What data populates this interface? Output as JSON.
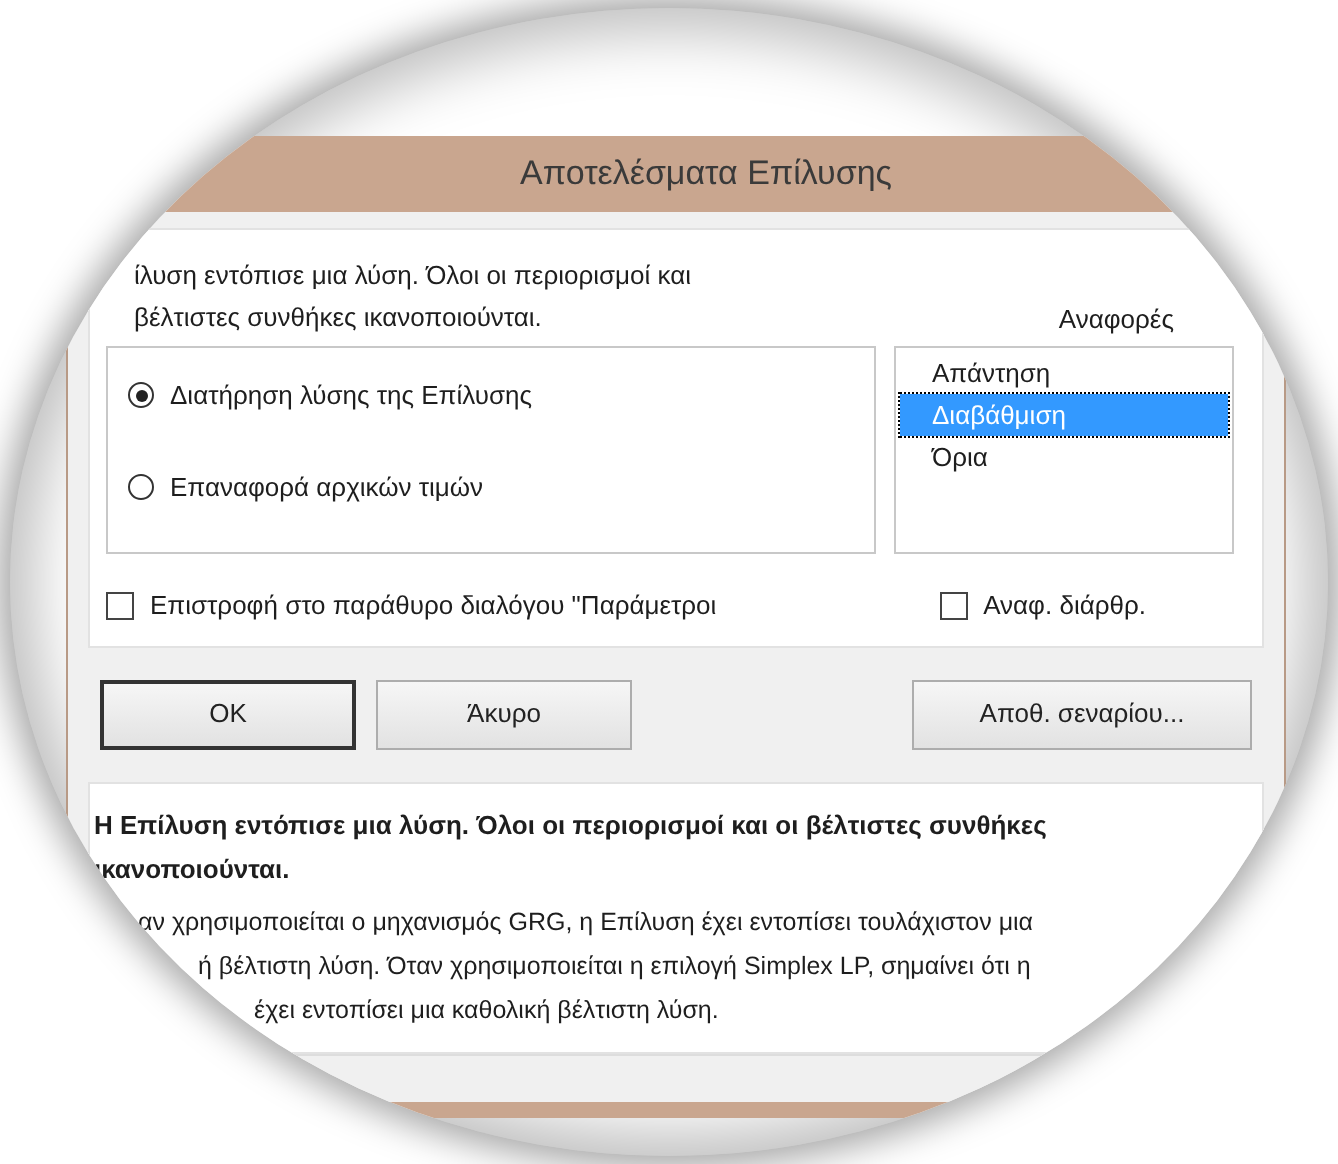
{
  "window": {
    "title": "Αποτελέσματα Επίλυσης"
  },
  "message_lines": [
    "ίλυση εντόπισε μια λύση. Όλοι οι περιορισμοί και",
    "βέλτιστες συνθήκες ικανοποιούνται."
  ],
  "options": [
    {
      "label": "Διατήρηση λύσης της Επίλυσης",
      "selected": true
    },
    {
      "label": "Επαναφορά αρχικών τιμών",
      "selected": false
    }
  ],
  "reports": {
    "label": "Αναφορές",
    "items": [
      {
        "label": "Απάντηση",
        "selected": false
      },
      {
        "label": "Διαβάθμιση",
        "selected": true
      },
      {
        "label": "Όρια",
        "selected": false
      }
    ]
  },
  "checkboxes": [
    {
      "label": "Επιστροφή στο παράθυρο διαλόγου \"Παράμετροι",
      "checked": false
    },
    {
      "label": "Αναφ. διάρθρ.",
      "checked": false
    }
  ],
  "buttons": [
    {
      "label": "OK",
      "default": true
    },
    {
      "label": "Άκυρο",
      "default": false
    },
    {
      "label": "Αποθ. σεναρίου...",
      "default": false
    }
  ],
  "summary": {
    "heading_lines": [
      "Η Επίλυση εντόπισε μια λύση. Όλοι οι περιορισμοί και οι βέλτιστες συνθήκες",
      "ικανοποιούνται."
    ],
    "body_lines": [
      "αν χρησιμοποιείται ο μηχανισμός GRG, η Επίλυση έχει εντοπίσει τουλάχιστον μια",
      "ή βέλτιστη λύση. Όταν χρησιμοποιείται η επιλογή Simplex LP, σημαίνει ότι η",
      "έχει εντοπίσει μια καθολική βέλτιστη λύση."
    ]
  }
}
